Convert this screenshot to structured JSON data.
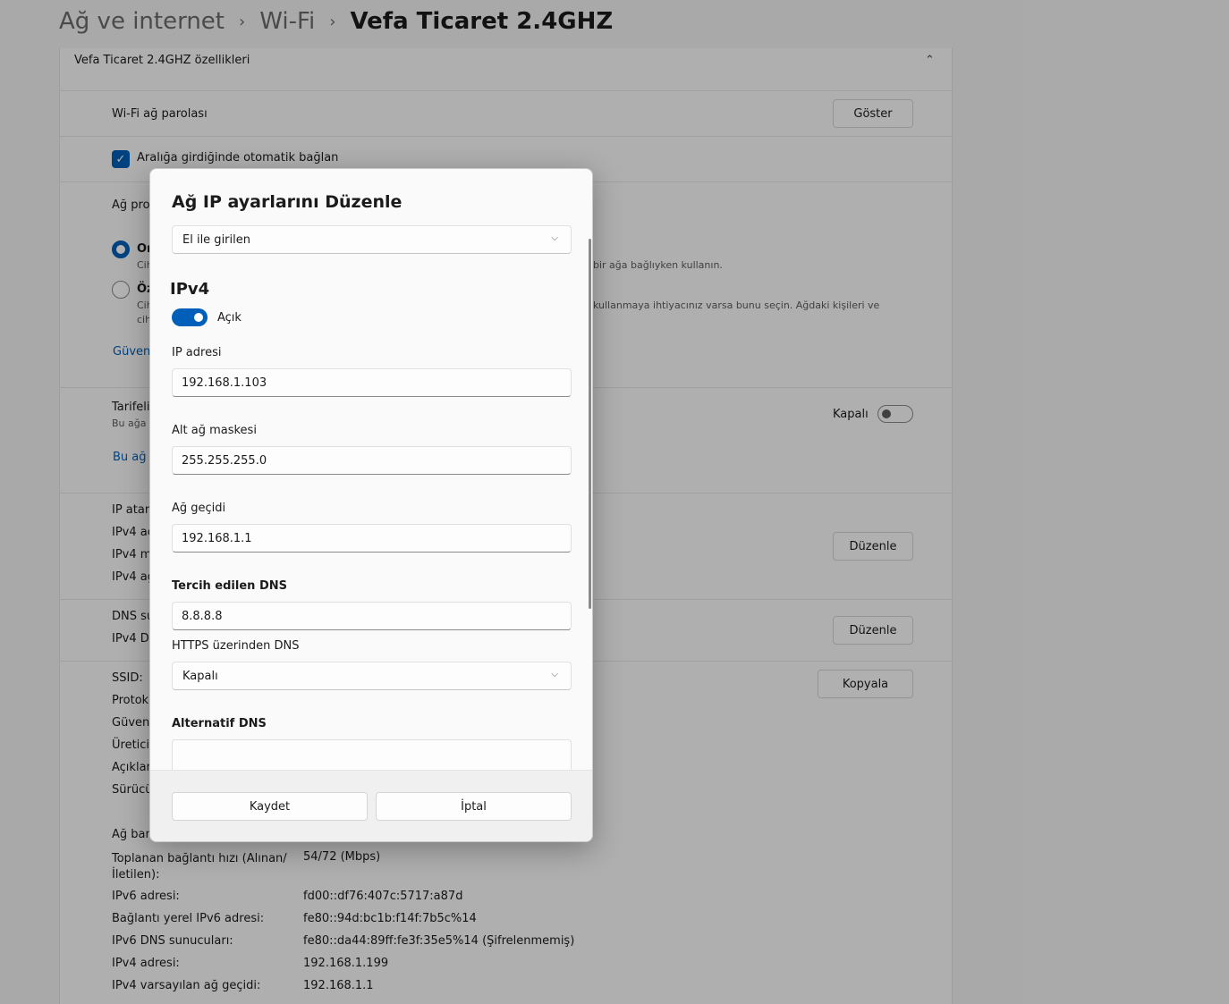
{
  "breadcrumb": {
    "level1": "Ağ ve internet",
    "level2": "Wi-Fi",
    "current": "Vefa Ticaret 2.4GHZ",
    "separator": "›"
  },
  "background": {
    "properties_header": "Vefa Ticaret 2.4GHZ özellikleri",
    "wifi_password_label": "Wi-Fi ağ parolası",
    "show_button": "Göster",
    "auto_connect_label": "Aralığa girdiğinde otomatik bağlan",
    "network_profile_partial": "Ağ pro",
    "radio1_partial": "Or",
    "radio1_desc_partial": "Cih",
    "radio1_desc_right": "bir ağa bağlıyken kullanın.",
    "radio2_partial": "Öz",
    "radio2_desc_partial": "Cih",
    "radio2_desc_partial2": "cih",
    "radio2_desc_right": "kullanmaya ihtiyacınız varsa bunu seçin. Ağdaki kişileri ve",
    "security_link_partial": "Güven",
    "metered_partial": "Tarifeli",
    "metered_desc_partial": "Bu ağa",
    "metered_toggle_label": "Kapalı",
    "data_link_partial": "Bu ağ",
    "ip_rows_partial": [
      "IP atam",
      "IPv4 ac",
      "IPv4 m",
      "IPv4 ağ"
    ],
    "edit_button": "Düzenle",
    "dns_rows_partial": [
      "DNS su",
      "IPv4 DI"
    ],
    "info_rows_partial": [
      "SSID:",
      "Protok",
      "Güven",
      "Üretici",
      "Açıklan",
      "Sürücü",
      "Ağ ban"
    ],
    "copy_button": "Kopyala",
    "details": [
      {
        "label": "Toplanan bağlantı hızı (Alınan/\nİletilen):",
        "value": "54/72 (Mbps)"
      },
      {
        "label": "IPv6 adresi:",
        "value": "fd00::df76:407c:5717:a87d"
      },
      {
        "label": "Bağlantı yerel IPv6 adresi:",
        "value": "fe80::94d:bc1b:f14f:7b5c%14"
      },
      {
        "label": "IPv6 DNS sunucuları:",
        "value": "fe80::da44:89ff:fe3f:35e5%14 (Şifrelenmemiş)"
      },
      {
        "label": "IPv4 adresi:",
        "value": "192.168.1.199"
      },
      {
        "label": "IPv4 varsayılan ağ geçidi:",
        "value": "192.168.1.1"
      }
    ]
  },
  "dialog": {
    "title": "Ağ IP ayarlarını Düzenle",
    "mode_select": "El ile girilen",
    "ipv4_heading": "IPv4",
    "ipv4_toggle_label": "Açık",
    "ip_address_label": "IP adresi",
    "ip_address_value": "192.168.1.103",
    "subnet_label": "Alt ağ maskesi",
    "subnet_value": "255.255.255.0",
    "gateway_label": "Ağ geçidi",
    "gateway_value": "192.168.1.1",
    "preferred_dns_label": "Tercih edilen DNS",
    "preferred_dns_value": "8.8.8.8",
    "https_dns_label": "HTTPS üzerinden DNS",
    "https_dns_select": "Kapalı",
    "alternate_dns_label": "Alternatif DNS",
    "save_button": "Kaydet",
    "cancel_button": "İptal"
  },
  "colors": {
    "accent": "#005fb8",
    "overlay": "rgba(0,0,0,0.30)"
  },
  "icons": {
    "chevron_down": "⌵",
    "chevron_up": "⌃",
    "check": "✓"
  }
}
